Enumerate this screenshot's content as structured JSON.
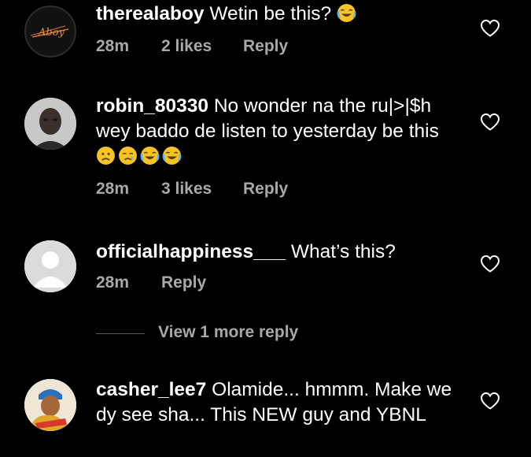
{
  "comments": [
    {
      "username": "therealaboy",
      "text": "Wetin be this?",
      "emojis": [
        "joy"
      ],
      "time": "28m",
      "likes": "2 likes",
      "reply": "Reply",
      "avatar_logo_text": "Aboy"
    },
    {
      "username": "robin_80330",
      "text": "No wonder na the ru|>|$h wey baddo de listen to yesterday be this",
      "emojis": [
        "slightly-frowning",
        "crying",
        "joy",
        "joy"
      ],
      "time": "28m",
      "likes": "3 likes",
      "reply": "Reply"
    },
    {
      "username": "officialhappiness___",
      "text": "What’s this?",
      "emojis": [],
      "time": "28m",
      "reply": "Reply"
    },
    {
      "username": "casher_lee7",
      "text": "Olamide... hmmm. Make we dy see sha... This NEW  guy and YBNL",
      "emojis": []
    }
  ],
  "view_more": "View 1 more reply",
  "colors": {
    "background": "#000000",
    "text": "#ffffff",
    "muted": "#a8a8a8",
    "emoji_face": "#f7c325"
  },
  "icons": {
    "like": "heart-outline-icon"
  }
}
